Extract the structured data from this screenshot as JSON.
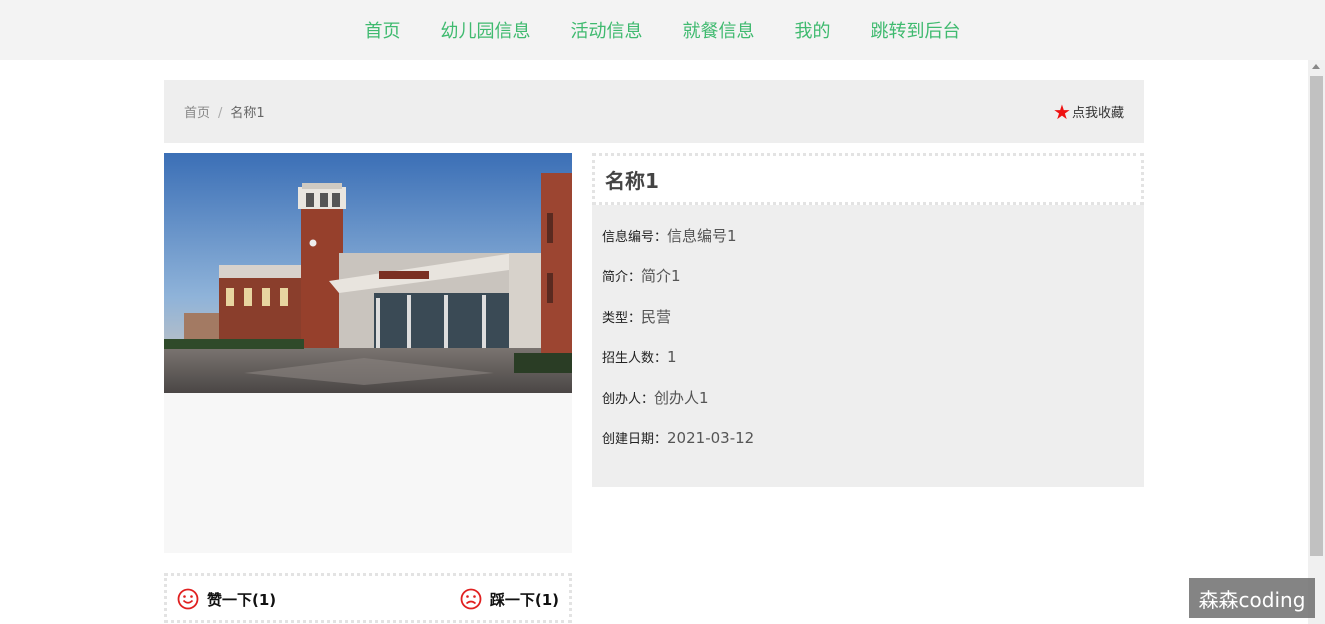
{
  "nav": {
    "items": [
      {
        "label": "首页"
      },
      {
        "label": "幼儿园信息"
      },
      {
        "label": "活动信息"
      },
      {
        "label": "就餐信息"
      },
      {
        "label": "我的"
      },
      {
        "label": "跳转到后台"
      }
    ],
    "color": "#3fba6f"
  },
  "breadcrumb": {
    "home": "首页",
    "separator": "/",
    "current": "名称1"
  },
  "collect": {
    "icon": "star-icon",
    "label": "点我收藏",
    "color": "#ee1111"
  },
  "detail": {
    "title": "名称1",
    "fields": [
      {
        "label": "信息编号：",
        "value": "信息编号1"
      },
      {
        "label": "简介：",
        "value": "简介1"
      },
      {
        "label": "类型：",
        "value": "民营"
      },
      {
        "label": "招生人数：",
        "value": "1"
      },
      {
        "label": "创办人：",
        "value": "创办人1"
      },
      {
        "label": "创建日期：",
        "value": "2021-03-12"
      }
    ]
  },
  "votes": {
    "like": {
      "icon": "smile-icon",
      "label": "赞一下(1)"
    },
    "dislike": {
      "icon": "frown-icon",
      "label": "踩一下(1)"
    },
    "icon_color": "#e02020"
  },
  "watermark": "森森coding"
}
